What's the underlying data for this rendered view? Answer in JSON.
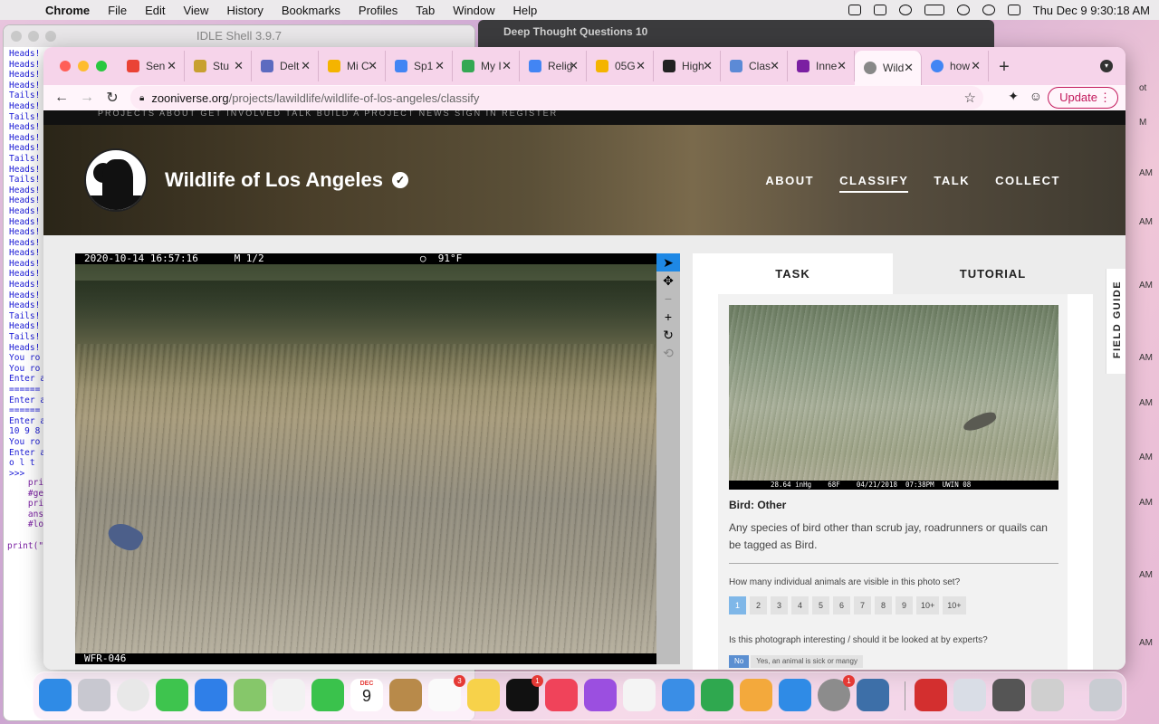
{
  "menubar": {
    "app": "Chrome",
    "items": [
      "File",
      "Edit",
      "View",
      "History",
      "Bookmarks",
      "Profiles",
      "Tab",
      "Window",
      "Help"
    ],
    "clock": "Thu Dec 9  9:30:18 AM"
  },
  "idle": {
    "title": "IDLE Shell 3.9.7",
    "output": "Heads!\nHeads!\nHeads!\nHeads!\nTails!\nHeads!\nTails!\nHeads!\nHeads!\nHeads!\nTails!\nHeads!\nTails!\nHeads!\nHeads!\nHeads!\nHeads!\nHeads!\nHeads!\nHeads!\nHeads!\nHeads!\nHeads!\nHeads!\nHeads!\nTails!\nHeads!\nTails!\nHeads!\nYou ro\nYou ro\nEnter a\n======\nEnter a\n======\nEnter a\n10 9 8\nYou ro\nEnter a\no l t\n>>>",
    "code": "    pri\n    #ge\n    pri\n    ans\n    #lo\n\nprint(\""
  },
  "bgwindow": {
    "title": "Deep Thought Questions 10"
  },
  "edge_times": [
    "ot",
    "M",
    "AM",
    "AM",
    "AM",
    "AM",
    "AM",
    "AM",
    "AM",
    "AM",
    "AM"
  ],
  "tabs": [
    {
      "label": "Sen",
      "color": "#ea4335"
    },
    {
      "label": "Stu",
      "color": "#c8a030"
    },
    {
      "label": "Delt",
      "color": "#5c6bc0"
    },
    {
      "label": "Mi C",
      "color": "#f4b400"
    },
    {
      "label": "Sp1",
      "color": "#4285f4"
    },
    {
      "label": "My I",
      "color": "#34a853"
    },
    {
      "label": "Relig",
      "color": "#4285f4"
    },
    {
      "label": "05G",
      "color": "#f4b400"
    },
    {
      "label": "High",
      "color": "#222222"
    },
    {
      "label": "Clas",
      "color": "#5c8ad6"
    },
    {
      "label": "Inne",
      "color": "#7b1fa2"
    },
    {
      "label": "Wild",
      "color": "#888888"
    },
    {
      "label": "how",
      "color": "#4285f4"
    }
  ],
  "url": {
    "host": "zooniverse.org",
    "path": "/projects/lawildlife/wildlife-of-los-angeles/classify"
  },
  "update_label": "Update",
  "topnav": "PROJECTS   ABOUT   GET INVOLVED   TALK   BUILD A PROJECT   NEWS                                                                                                   SIGN IN   REGISTER",
  "project": {
    "title": "Wildlife of Los Angeles",
    "nav": [
      "ABOUT",
      "CLASSIFY",
      "TALK",
      "COLLECT"
    ]
  },
  "subject": {
    "header": "2020-10-14 16:57:16      M 1/2                          ○  91°F",
    "footer": "WFR-046"
  },
  "task_tabs": [
    "TASK",
    "TUTORIAL"
  ],
  "field_guide": "FIELD GUIDE",
  "example": {
    "footer": "28.64 inHg    68F    04/21/2018  07:38PM  UWIN 08"
  },
  "choice": {
    "title": "Bird: Other",
    "description": "Any species of bird other than scrub jay, roadrunners or quails can be tagged as Bird."
  },
  "question1": "How many individual animals are visible in this photo set?",
  "counts": [
    "1",
    "2",
    "3",
    "4",
    "5",
    "6",
    "7",
    "8",
    "9",
    "10+",
    "10+"
  ],
  "question2": "Is this photograph interesting / should it be looked at by experts?",
  "answers": [
    "No",
    "Yes, an animal is sick or mangy"
  ],
  "dock": {
    "calendar_month": "DEC",
    "calendar_day": "9",
    "badges": [
      "1",
      "3",
      "1",
      "1"
    ]
  }
}
